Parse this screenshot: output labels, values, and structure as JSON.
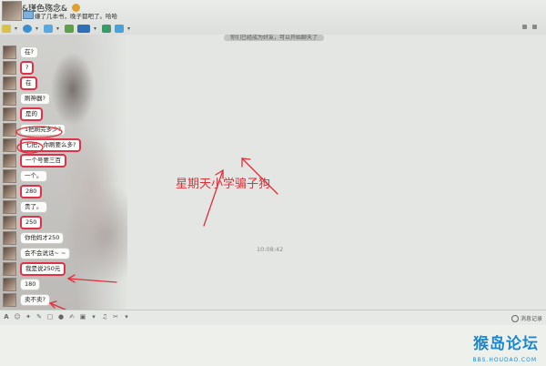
{
  "header": {
    "title": "&瑾色殇念&",
    "status_text": "",
    "signature": "嫌了几本书，晚子都吧了。哈哈"
  },
  "toolbar": {
    "icons": [
      "mic-icon",
      "video-icon",
      "file-transfer-icon",
      "screen-share-icon",
      "remote-desktop-icon",
      "app-icon",
      "more-icon"
    ]
  },
  "chat": {
    "notice": "你们已经成为好友，可以开始聊天了",
    "timestamp": "10:08:42",
    "caption": "星期天小学骗子狗",
    "messages": [
      {
        "text": "在?",
        "highlighted": false
      },
      {
        "text": "?",
        "highlighted": true
      },
      {
        "text": "在",
        "highlighted": true
      },
      {
        "text": "刷神器?",
        "highlighted": false
      },
      {
        "text": "是的",
        "highlighted": true
      },
      {
        "text": "1把刷完多少?",
        "highlighted": false
      },
      {
        "text": "七把，你刷要么多?",
        "highlighted": true
      },
      {
        "text": "一个号要三百",
        "highlighted": true
      },
      {
        "text": "一个。",
        "highlighted": false
      },
      {
        "text": "280",
        "highlighted": true
      },
      {
        "text": "贵了。",
        "highlighted": false
      },
      {
        "text": "250",
        "highlighted": true
      },
      {
        "text": "你他妈才250",
        "highlighted": false
      },
      {
        "text": "会不会说话~ ~",
        "highlighted": false
      },
      {
        "text": "我是说250元",
        "highlighted": true
      },
      {
        "text": "180",
        "highlighted": false
      },
      {
        "text": "卖不卖?",
        "highlighted": false
      }
    ],
    "annotation_color": "#e0303a"
  },
  "input": {
    "history_label": "消息记录"
  },
  "watermark": {
    "brand": "猴岛论坛",
    "url": "BBS.HOUDAO.COM"
  }
}
